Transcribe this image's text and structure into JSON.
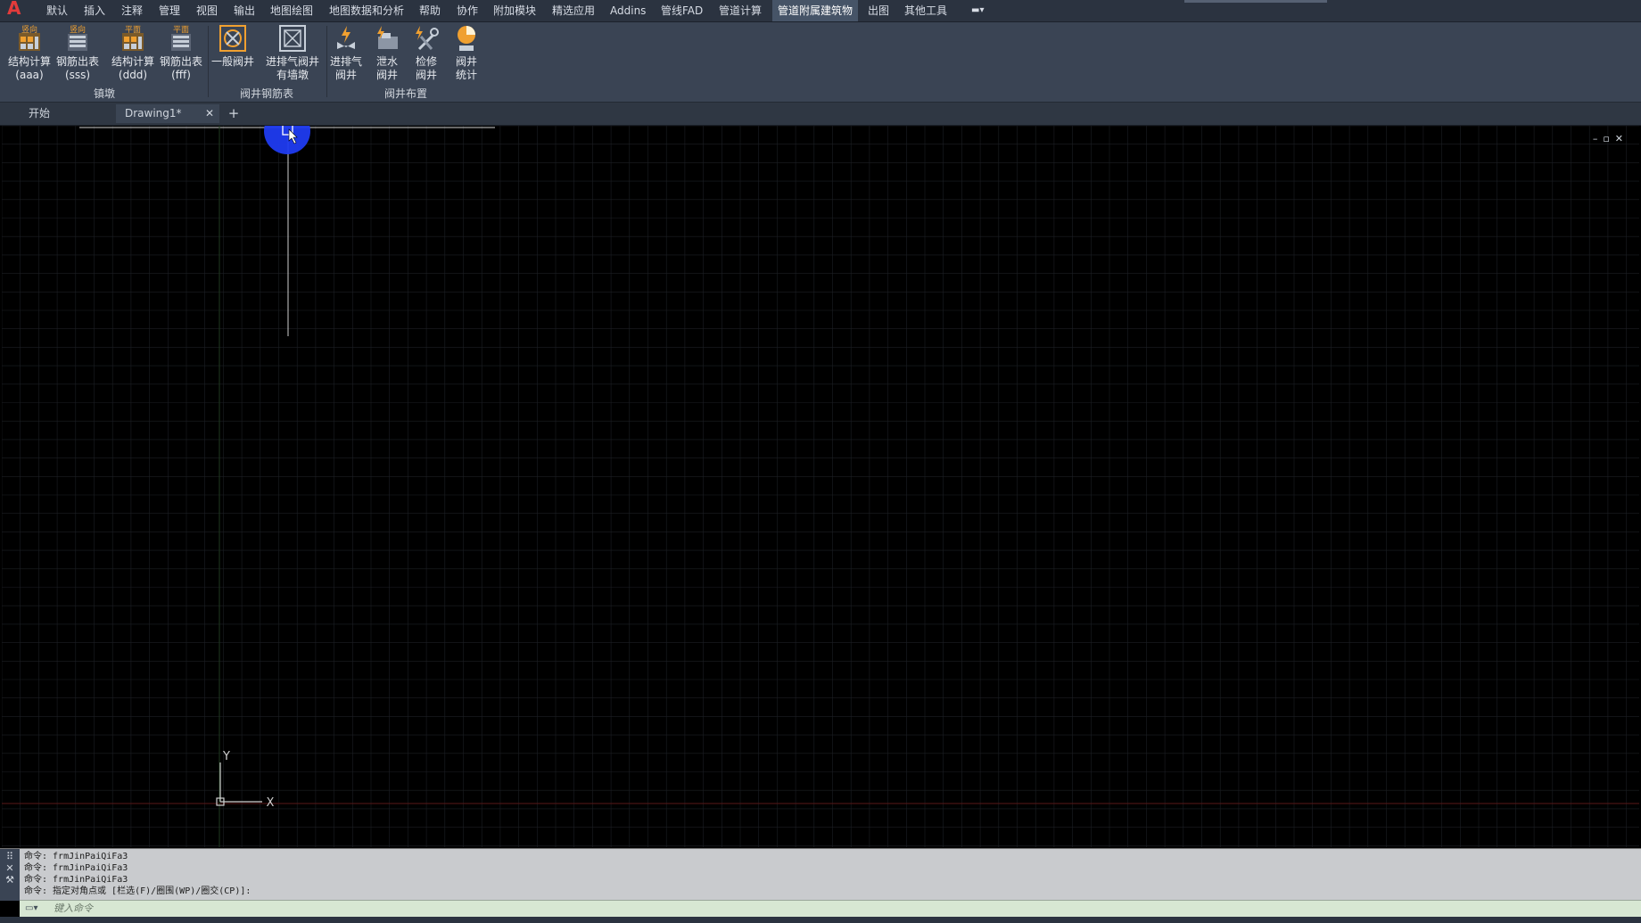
{
  "app": {
    "logo": "A"
  },
  "menu": {
    "items": [
      "默认",
      "插入",
      "注释",
      "管理",
      "视图",
      "输出",
      "地图绘图",
      "地图数据和分析",
      "帮助",
      "协作",
      "附加模块",
      "精选应用",
      "Addins",
      "管线FAD",
      "管道计算",
      "管道附属建筑物",
      "出图",
      "其他工具"
    ],
    "active": "管道附属建筑物"
  },
  "ribbon": {
    "panels": [
      {
        "title": "镇墩",
        "buttons": [
          {
            "top": "竖向",
            "line1": "结构计算",
            "line2": "(aaa)",
            "icon": "structure-calc-icon"
          },
          {
            "top": "竖向",
            "line1": "钢筋出表",
            "line2": "(sss)",
            "icon": "rebar-table-icon"
          },
          {
            "top": "平面",
            "line1": "结构计算",
            "line2": "(ddd)",
            "icon": "structure-calc-icon"
          },
          {
            "top": "平面",
            "line1": "钢筋出表",
            "line2": "(fff)",
            "icon": "rebar-table-icon"
          }
        ]
      },
      {
        "title": "阀井钢筋表",
        "buttons": [
          {
            "line1": "一般阀井",
            "line2": "",
            "icon": "valve-well-icon"
          },
          {
            "line1": "进排气阀井",
            "line2": "有墙墩",
            "icon": "air-valve-well-icon"
          }
        ]
      },
      {
        "title": "阀井布置",
        "buttons": [
          {
            "line1": "进排气",
            "line2": "阀井",
            "icon": "air-intake-icon"
          },
          {
            "line1": "泄水",
            "line2": "阀井",
            "icon": "drain-icon"
          },
          {
            "line1": "检修",
            "line2": "阀井",
            "icon": "maintenance-icon"
          },
          {
            "line1": "阀井",
            "line2": "统计",
            "icon": "statistics-icon"
          }
        ]
      }
    ]
  },
  "tabs": {
    "start": "开始",
    "drawing": "Drawing1*",
    "close": "✕",
    "add": "+"
  },
  "viewport": {
    "controls": "–▫✕",
    "ucs_x": "X",
    "ucs_y": "Y"
  },
  "command": {
    "history": [
      "命令: frmJinPaiQiFa3",
      "命令: frmJinPaiQiFa3",
      "命令: frmJinPaiQiFa3",
      "命令: 指定对角点或 [栏选(F)/圈围(WP)/圈交(CP)]:"
    ],
    "placeholder": "键入命令"
  },
  "colors": {
    "accent_cursor": "#1f3bf0",
    "ribbon_icon": "#f0a030",
    "grid": "#1c1f24"
  }
}
